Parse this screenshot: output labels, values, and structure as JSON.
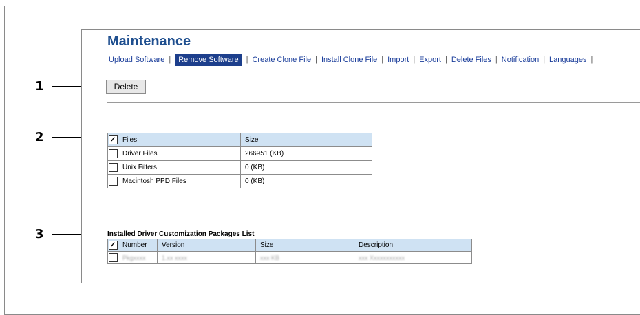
{
  "page_title": "Maintenance",
  "tabs": [
    {
      "label": "Upload Software",
      "active": false
    },
    {
      "label": "Remove Software",
      "active": true
    },
    {
      "label": "Create Clone File",
      "active": false
    },
    {
      "label": "Install Clone File",
      "active": false
    },
    {
      "label": "Import",
      "active": false
    },
    {
      "label": "Export",
      "active": false
    },
    {
      "label": "Delete Files",
      "active": false
    },
    {
      "label": "Notification",
      "active": false
    },
    {
      "label": "Languages",
      "active": false
    }
  ],
  "delete_button_label": "Delete",
  "files_table": {
    "headers": {
      "files": "Files",
      "size": "Size"
    },
    "header_checked": true,
    "rows": [
      {
        "file": "Driver Files",
        "size": "266951 (KB)",
        "checked": false
      },
      {
        "file": "Unix Filters",
        "size": "0 (KB)",
        "checked": false
      },
      {
        "file": "Macintosh PPD Files",
        "size": "0 (KB)",
        "checked": false
      }
    ]
  },
  "packages": {
    "title": "Installed Driver Customization Packages List",
    "headers": {
      "number": "Number",
      "version": "Version",
      "size": "Size",
      "description": "Description"
    },
    "header_checked": true,
    "rows": [
      {
        "number": "Pkgxxxx",
        "version": "1.xx xxxx",
        "size": "xxx KB",
        "description": "xxx Xxxxxxxxxxx",
        "checked": false
      }
    ]
  },
  "callouts": [
    "1",
    "2",
    "3"
  ],
  "colors": {
    "title": "#1f4f8f",
    "active_tab_bg": "#1d3f8c",
    "link": "#1a3d9a",
    "table_header_bg": "#cfe2f3"
  }
}
